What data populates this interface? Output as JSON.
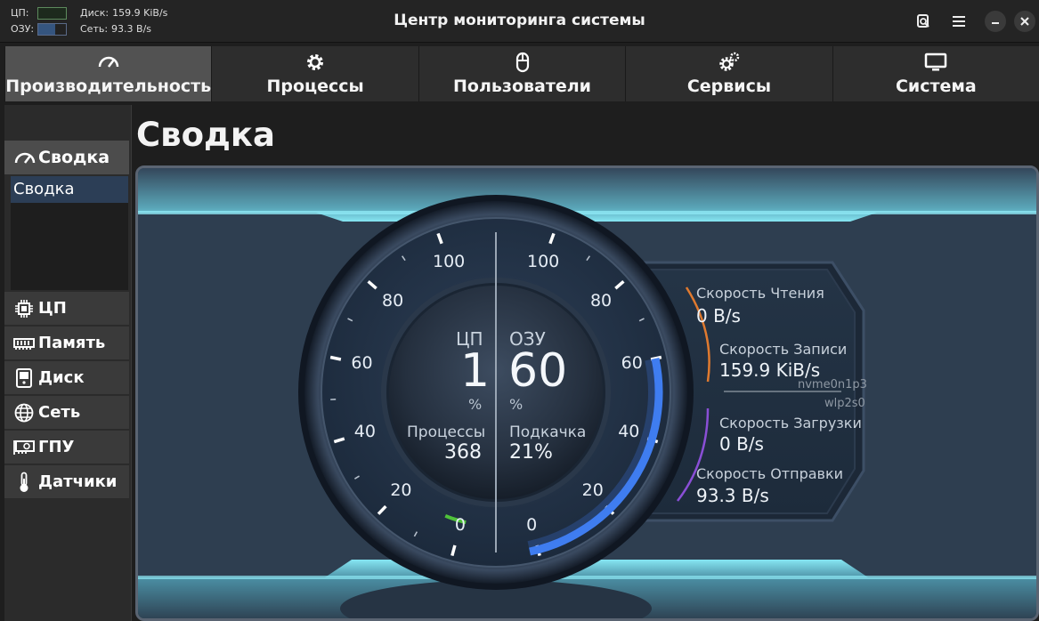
{
  "titlebar": {
    "title": "Центр мониторинга системы",
    "cpu_label": "ЦП:",
    "ram_label": "ОЗУ:",
    "disk_label": "Диск:",
    "disk_value": "159.9 KiB/s",
    "net_label": "Сеть:",
    "net_value": "93.3 B/s",
    "cpu_level": 0.01,
    "ram_level": 0.6
  },
  "tabs": [
    {
      "label": "Производительность",
      "icon": "gauge-icon"
    },
    {
      "label": "Процессы",
      "icon": "gear-icon"
    },
    {
      "label": "Пользователи",
      "icon": "mouse-icon"
    },
    {
      "label": "Сервисы",
      "icon": "gears-icon"
    },
    {
      "label": "Система",
      "icon": "monitor-icon"
    }
  ],
  "sidebar": {
    "header": "Сводка",
    "selected_item": "Сводка",
    "items": [
      {
        "label": "ЦП",
        "icon": "cpu-icon"
      },
      {
        "label": "Память",
        "icon": "memory-icon"
      },
      {
        "label": "Диск",
        "icon": "disk-icon"
      },
      {
        "label": "Сеть",
        "icon": "globe-icon"
      },
      {
        "label": "ГПУ",
        "icon": "gpu-icon"
      },
      {
        "label": "Датчики",
        "icon": "thermometer-icon"
      }
    ]
  },
  "page": {
    "title": "Сводка"
  },
  "gauge": {
    "left_ticks": [
      "100",
      "80",
      "60",
      "40",
      "20",
      "0"
    ],
    "right_ticks": [
      "100",
      "80",
      "60",
      "40",
      "20",
      "0"
    ],
    "cpu_label": "ЦП",
    "cpu_value": "1",
    "cpu_unit": "%",
    "ram_label": "ОЗУ",
    "ram_value": "60",
    "ram_unit": "%",
    "processes_label": "Процессы",
    "processes_value": "368",
    "swap_label": "Подкачка",
    "swap_value": "21%",
    "cpu_percent": 1,
    "ram_percent": 60
  },
  "io": {
    "read_label": "Скорость Чтения",
    "read_value": "0 B/s",
    "write_label": "Скорость Записи",
    "write_value": "159.9 KiB/s",
    "disk_device": "nvme0n1p3",
    "net_device": "wlp2s0",
    "download_label": "Скорость Загрузки",
    "download_value": "0 B/s",
    "upload_label": "Скорость Отправки",
    "upload_value": "93.3 B/s"
  },
  "colors": {
    "ram_arc": "#3f7df0",
    "cpu_arc": "#4fc23a",
    "disk_arc": "#e07a2f",
    "net_arc": "#8a4fd6",
    "glow": "#7fe3f2"
  }
}
